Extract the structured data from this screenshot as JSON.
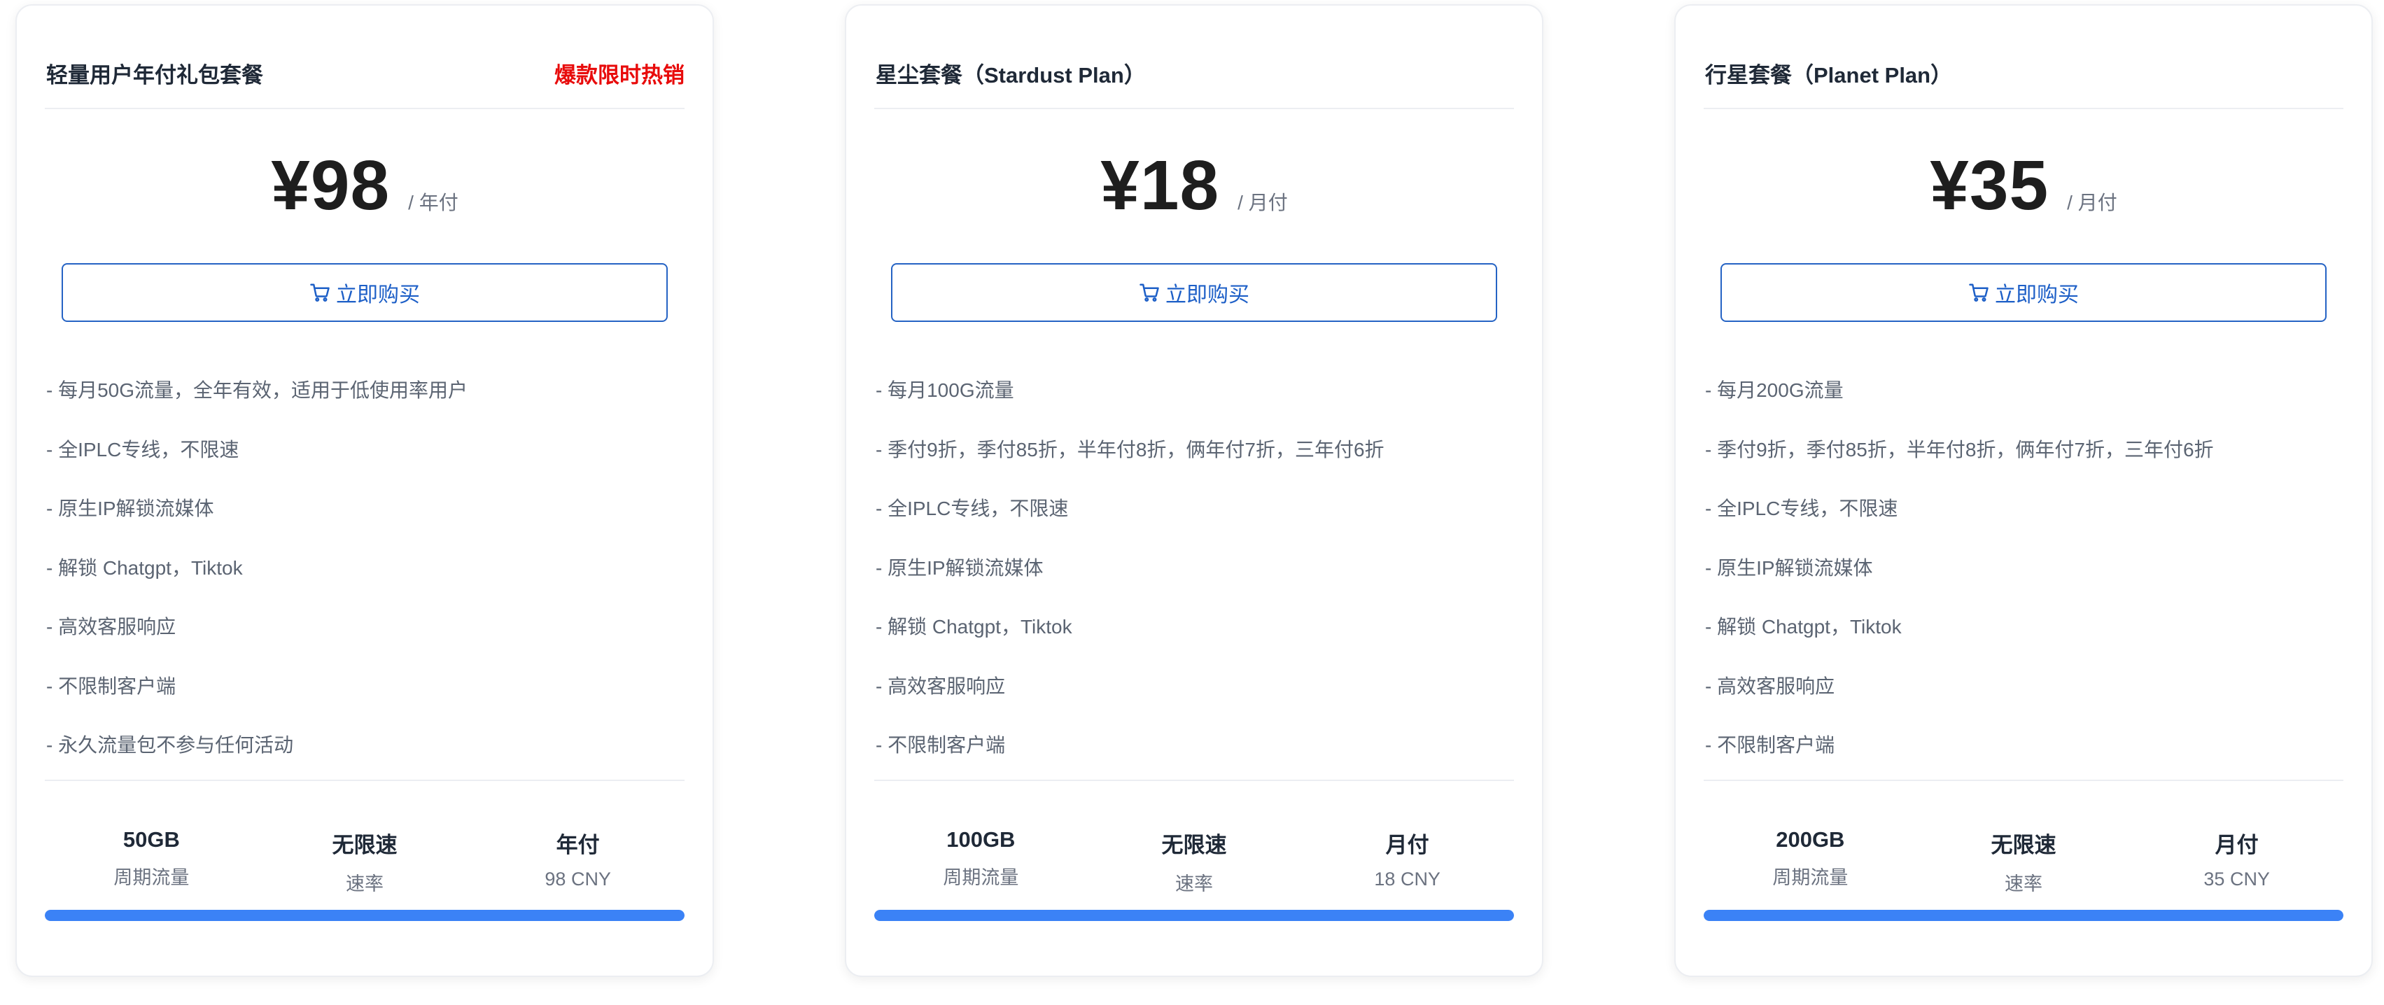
{
  "accent_color": "#3b82f6",
  "badge_color": "#e80b0b",
  "plans": [
    {
      "title": "轻量用户年付礼包套餐",
      "badge": "爆款限时热销",
      "price": "¥98",
      "period": "/ 年付",
      "buy_label": "立即购买",
      "buy_icon": "cart-icon",
      "features": [
        "- 每月50G流量，全年有效，适用于低使用率用户",
        "- 全IPLC专线，不限速",
        "- 原生IP解锁流媒体",
        "- 解锁 Chatgpt，Tiktok",
        "- 高效客服响应",
        "- 不限制客户端",
        "- 永久流量包不参与任何活动"
      ],
      "stats": [
        {
          "value": "50GB",
          "label": "周期流量"
        },
        {
          "value": "无限速",
          "label": "速率"
        },
        {
          "value": "年付",
          "label": "98 CNY"
        }
      ],
      "progress": 1.0
    },
    {
      "title": "星尘套餐（Stardust Plan）",
      "badge": "",
      "price": "¥18",
      "period": "/ 月付",
      "buy_label": "立即购买",
      "buy_icon": "cart-icon",
      "features": [
        "- 每月100G流量",
        "- 季付9折，季付85折，半年付8折，俩年付7折，三年付6折",
        "- 全IPLC专线，不限速",
        "- 原生IP解锁流媒体",
        "- 解锁 Chatgpt，Tiktok",
        "- 高效客服响应",
        "- 不限制客户端"
      ],
      "stats": [
        {
          "value": "100GB",
          "label": "周期流量"
        },
        {
          "value": "无限速",
          "label": "速率"
        },
        {
          "value": "月付",
          "label": "18 CNY"
        }
      ],
      "progress": 1.0
    },
    {
      "title": "行星套餐（Planet Plan）",
      "badge": "",
      "price": "¥35",
      "period": "/ 月付",
      "buy_label": "立即购买",
      "buy_icon": "cart-icon",
      "features": [
        "- 每月200G流量",
        "- 季付9折，季付85折，半年付8折，俩年付7折，三年付6折",
        "- 全IPLC专线，不限速",
        "- 原生IP解锁流媒体",
        "- 解锁 Chatgpt，Tiktok",
        "- 高效客服响应",
        "- 不限制客户端"
      ],
      "stats": [
        {
          "value": "200GB",
          "label": "周期流量"
        },
        {
          "value": "无限速",
          "label": "速率"
        },
        {
          "value": "月付",
          "label": "35 CNY"
        }
      ],
      "progress": 1.0
    }
  ]
}
